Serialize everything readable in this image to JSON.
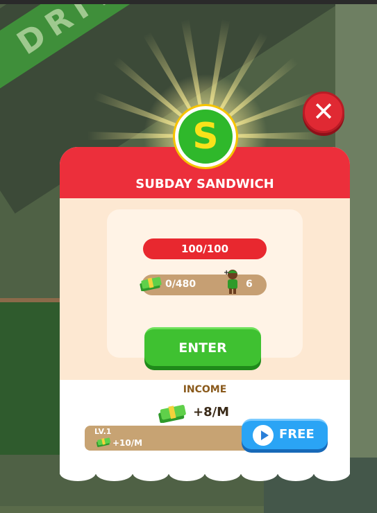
{
  "popup": {
    "title": "SUBDAY SANDWICH",
    "badge_letter": "S",
    "progress_text": "100/100",
    "cash_text": "0/480",
    "workers_text": "6",
    "enter_label": "ENTER",
    "income_label": "INCOME",
    "income_value": "+8/M",
    "level_label": "LV.1",
    "level_income": "+10/M",
    "free_label": "FREE"
  },
  "background": {
    "banner_text": "DRIVE THR"
  },
  "icons": {
    "close": "close-icon",
    "money": "money-stack-icon",
    "worker": "worker-icon",
    "play": "play-icon"
  },
  "colors": {
    "header_red": "#ec2f3b",
    "enter_green": "#3fc131",
    "free_blue": "#2aa4f5",
    "badge_green": "#2fb82b",
    "badge_letter": "#f8e21a"
  }
}
